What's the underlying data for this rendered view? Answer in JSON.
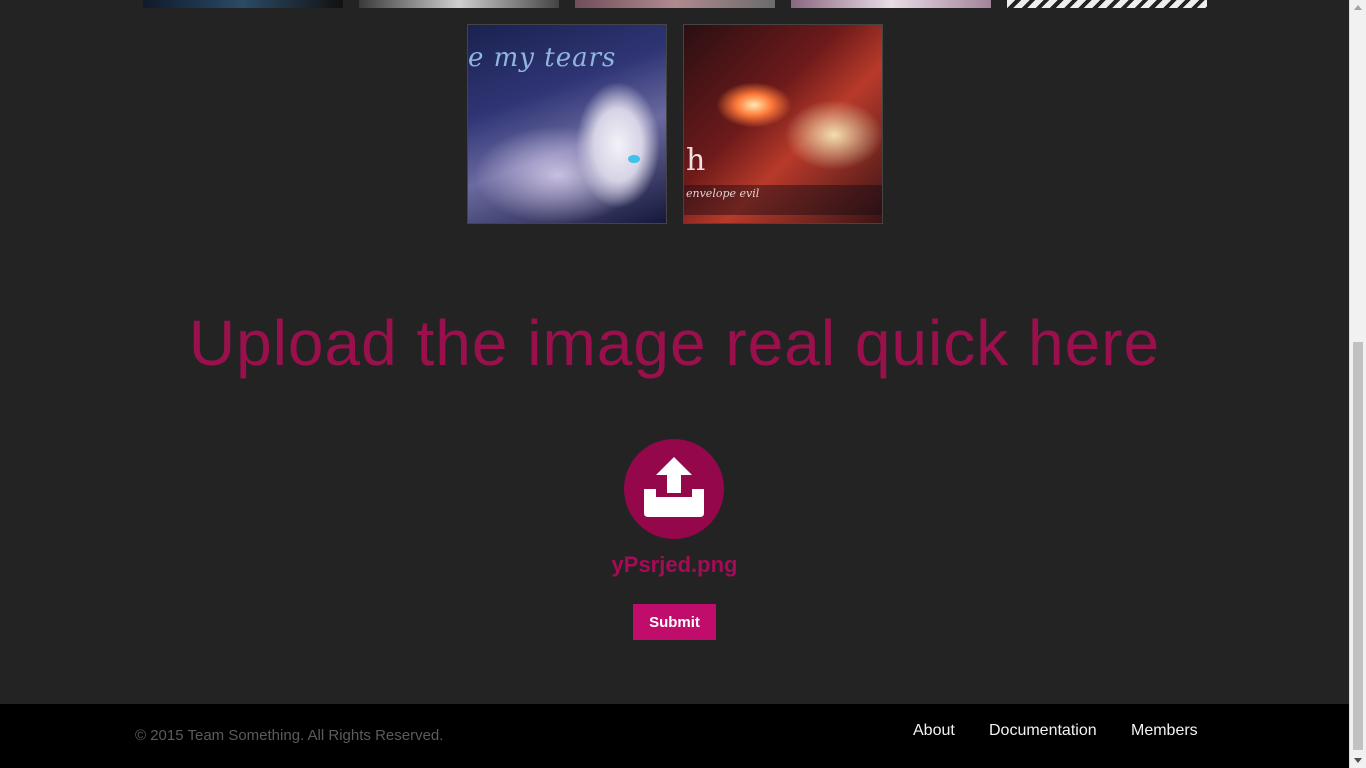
{
  "gallery": {
    "top_strip_count": 5,
    "images": [
      {
        "name": "anime-girl-tears-thumbnail",
        "overlay_text": "e my tears"
      },
      {
        "name": "red-fire-art-thumbnail",
        "overlay_text": "h",
        "caption": "envelope evil"
      }
    ]
  },
  "upload": {
    "heading": "Upload the image real quick here",
    "icon": "upload-tray-icon",
    "filename": "yPsrjed.png",
    "submit_label": "Submit"
  },
  "footer": {
    "copyright": "© 2015 Team Something. All Rights Reserved.",
    "nav": {
      "about": "About",
      "documentation": "Documentation",
      "members": "Members"
    }
  },
  "colors": {
    "background": "#232323",
    "accent": "#c00c6a",
    "heading": "#a0104f",
    "circle": "#94074a",
    "footer": "#000000"
  }
}
